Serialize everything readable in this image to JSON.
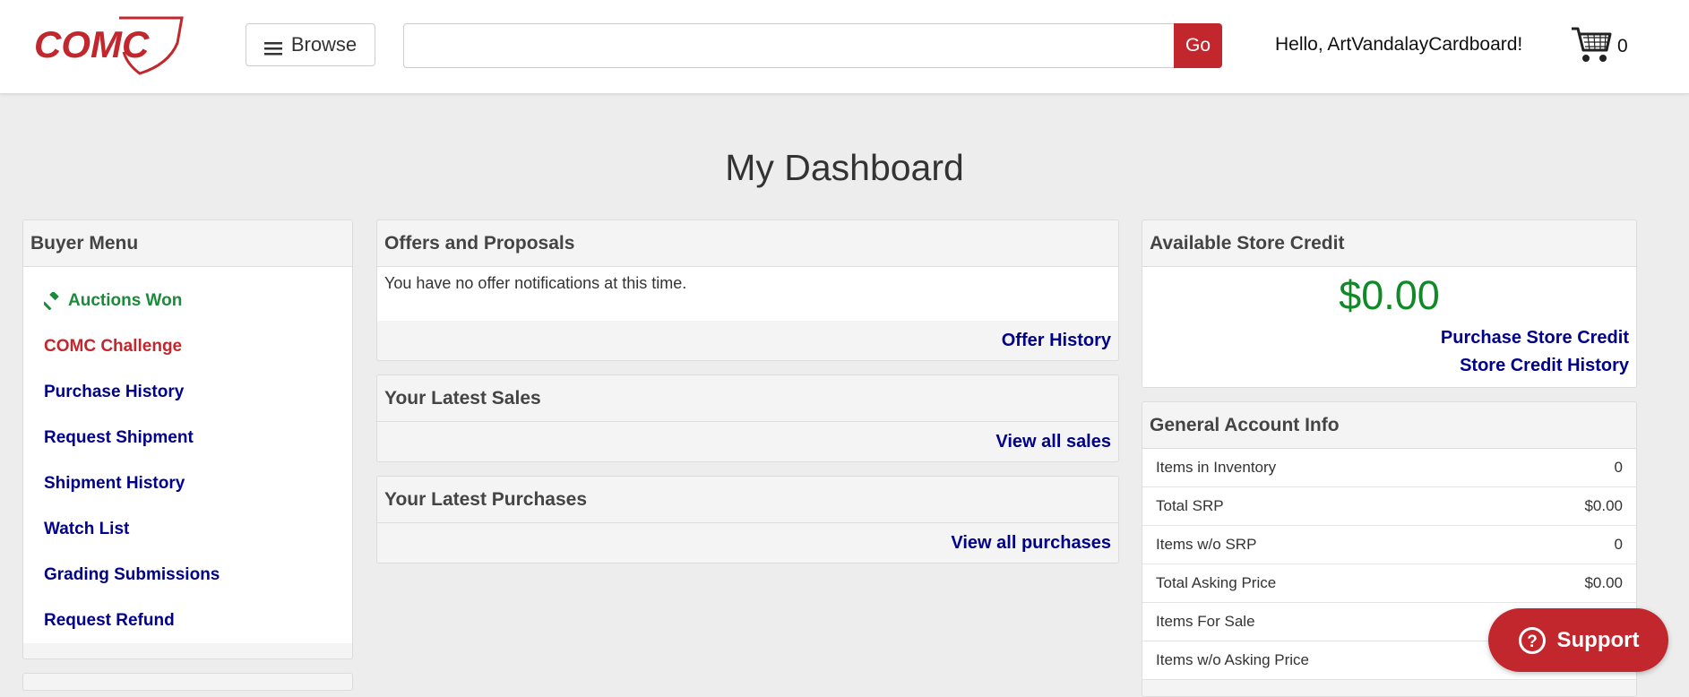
{
  "header": {
    "logo_text": "COMC",
    "browse_label": "Browse",
    "search_value": "",
    "search_placeholder": "",
    "go_label": "Go",
    "greeting": "Hello, ArtVandalayCardboard!",
    "cart_count": "0"
  },
  "page_title": "My Dashboard",
  "buyer_menu": {
    "title": "Buyer Menu",
    "items": [
      {
        "label": "Auctions Won",
        "icon": "gavel-icon",
        "color": "#1b8a3a"
      },
      {
        "label": "COMC Challenge",
        "color": "#c1272d"
      },
      {
        "label": "Purchase History",
        "color": "#00008b"
      },
      {
        "label": "Request Shipment",
        "color": "#00008b"
      },
      {
        "label": "Shipment History",
        "color": "#00008b"
      },
      {
        "label": "Watch List",
        "color": "#00008b"
      },
      {
        "label": "Grading Submissions",
        "color": "#00008b"
      },
      {
        "label": "Request Refund",
        "color": "#00008b"
      }
    ]
  },
  "offers": {
    "title": "Offers and Proposals",
    "message": "You have no offer notifications at this time.",
    "link": "Offer History"
  },
  "sales": {
    "title": "Your Latest Sales",
    "link": "View all sales"
  },
  "purchases": {
    "title": "Your Latest Purchases",
    "link": "View all purchases"
  },
  "store_credit": {
    "title": "Available Store Credit",
    "amount": "$0.00",
    "purchase_link": "Purchase Store Credit",
    "history_link": "Store Credit History"
  },
  "account_info": {
    "title": "General Account Info",
    "rows": [
      {
        "label": "Items in Inventory",
        "value": "0"
      },
      {
        "label": "Total SRP",
        "value": "$0.00"
      },
      {
        "label": "Items w/o SRP",
        "value": "0"
      },
      {
        "label": "Total Asking Price",
        "value": "$0.00"
      },
      {
        "label": "Items For Sale",
        "value": ""
      },
      {
        "label": "Items w/o Asking Price",
        "value": ""
      }
    ]
  },
  "support": {
    "label": "Support",
    "icon": "question-circle-icon"
  },
  "colors": {
    "brand_red": "#c1272d",
    "link_blue": "#00008b",
    "credit_green": "#0f8a27",
    "background": "#ededed"
  }
}
